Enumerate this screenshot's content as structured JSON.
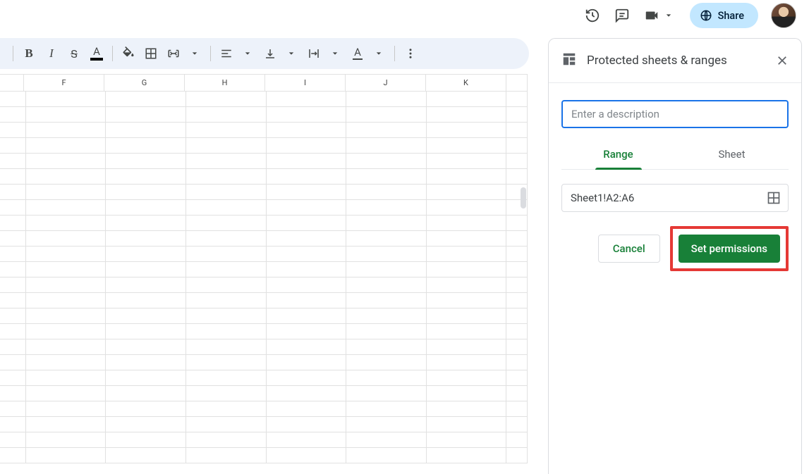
{
  "topbar": {
    "share_label": "Share"
  },
  "toolbar": {
    "collapsed": false
  },
  "columns": [
    "F",
    "G",
    "H",
    "I",
    "J",
    "K"
  ],
  "rows_count": 24,
  "panel": {
    "title": "Protected sheets & ranges",
    "description_placeholder": "Enter a description",
    "description_value": "",
    "tabs": {
      "range": "Range",
      "sheet": "Sheet",
      "active": "range"
    },
    "range_value": "Sheet1!A2:A6",
    "cancel_label": "Cancel",
    "set_permissions_label": "Set permissions"
  }
}
